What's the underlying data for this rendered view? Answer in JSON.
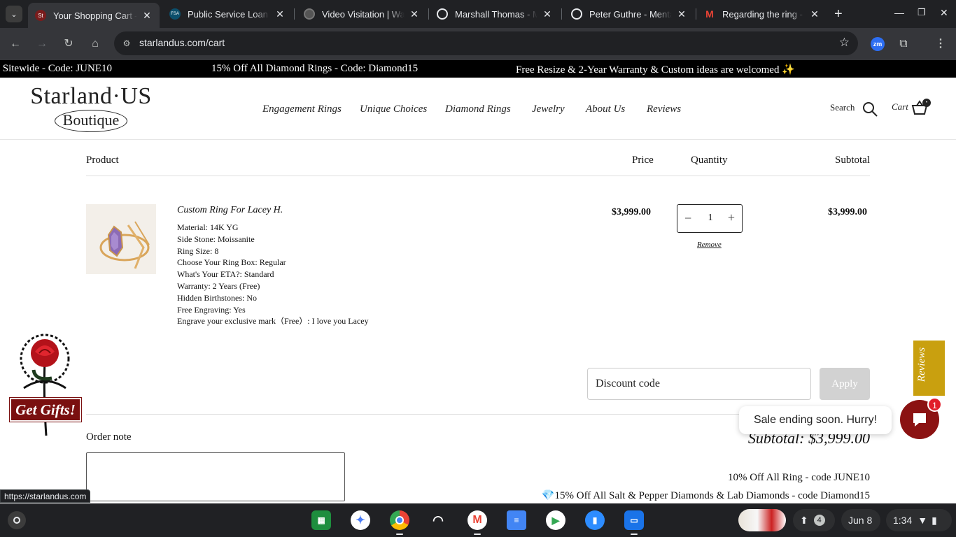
{
  "browser": {
    "tabs": [
      {
        "title": "Your Shopping Cart –",
        "favicon": "St",
        "active": true
      },
      {
        "title": "Public Service Loan Fo",
        "favicon": "FSA"
      },
      {
        "title": "Video Visitation | Was",
        "favicon": "globe"
      },
      {
        "title": "Marshall Thomas - Me",
        "favicon": "gear"
      },
      {
        "title": "Peter Guthre - Mental",
        "favicon": "gear"
      },
      {
        "title": "Regarding the ring - b",
        "favicon": "M"
      }
    ],
    "url": "starlandus.com/cart",
    "extension_label": "zm"
  },
  "announcement": {
    "items": [
      "f Sitewide - Code: JUNE10",
      "15% Off All Diamond Rings - Code: Diamond15",
      "Free Resize & 2-Year Warranty & Custom ideas are welcomed ✨"
    ]
  },
  "header": {
    "logo_top": "Starland·US",
    "logo_bottom": "Boutique",
    "nav": [
      "Engagement Rings",
      "Unique Choices",
      "Diamond Rings",
      "Jewelry",
      "About Us",
      "Reviews"
    ],
    "search_label": "Search",
    "cart_label": "Cart"
  },
  "cart": {
    "columns": {
      "product": "Product",
      "price": "Price",
      "quantity": "Quantity",
      "subtotal": "Subtotal"
    },
    "item": {
      "title": "Custom Ring For Lacey H.",
      "properties": [
        "Material: 14K YG",
        "Side Stone: Moissanite",
        "Ring Size: 8",
        "Choose Your Ring Box: Regular",
        "What's Your ETA?: Standard",
        "Warranty: 2 Years (Free)",
        "Hidden Birthstones: No",
        "Free Engraving: Yes",
        "Engrave your exclusive mark（Free）: I love you Lacey"
      ],
      "price": "$3,999.00",
      "quantity": "1",
      "subtotal": "$3,999.00",
      "remove_label": "Remove"
    },
    "discount_placeholder": "Discount code",
    "apply_label": "Apply",
    "order_note_label": "Order note",
    "subtotal_text": "Subtotal: $3,999.00",
    "promos": [
      "10% Off All Ring - code JUNE10",
      "💎15% Off All Salt & Pepper Diamonds & Lab Diamonds - code Diamond15"
    ]
  },
  "floating": {
    "gifts_label": "Get Gifts!",
    "reviews_tab": "Reviews",
    "sale_bubble": "Sale ending soon. Hurry!",
    "chat_badge": "1"
  },
  "status_url": "https://starlandus.com",
  "shelf": {
    "notification_count": "4",
    "date": "Jun 8",
    "time": "1:34"
  },
  "colors": {
    "brand_dark_red": "#8b1212",
    "reviews_gold": "#c9a00f",
    "chrome_dark": "#202124"
  }
}
